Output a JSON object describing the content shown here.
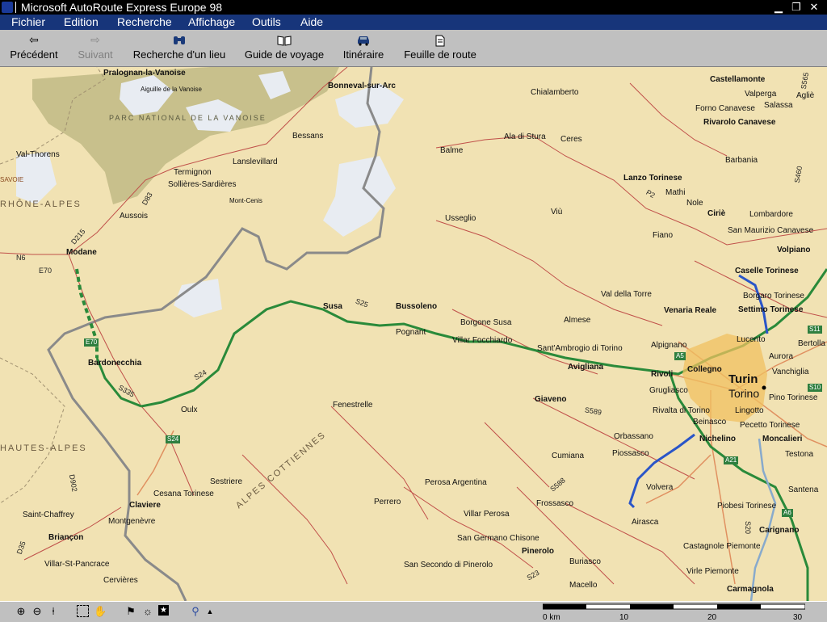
{
  "window": {
    "title": "Microsoft AutoRoute Express Europe 98"
  },
  "menu": [
    "Fichier",
    "Edition",
    "Recherche",
    "Affichage",
    "Outils",
    "Aide"
  ],
  "toolbar": [
    {
      "label": "Précédent",
      "icon": "back-arrow-icon",
      "enabled": true
    },
    {
      "label": "Suivant",
      "icon": "forward-arrow-icon",
      "enabled": false
    },
    {
      "label": "Recherche d'un lieu",
      "icon": "binoculars-icon",
      "enabled": true
    },
    {
      "label": "Guide de voyage",
      "icon": "book-icon",
      "enabled": true
    },
    {
      "label": "Itinéraire",
      "icon": "car-icon",
      "enabled": true
    },
    {
      "label": "Feuille de route",
      "icon": "document-icon",
      "enabled": true
    }
  ],
  "map": {
    "places": [
      "Pralognan-la-Vanoise",
      "Aiguille de la Vanoise",
      "Bonneval-sur-Arc",
      "PARC NATIONAL DE LA VANOISE",
      "Val-Thorens",
      "SAVOIE",
      "RHÔNE-ALPES",
      "Termignon",
      "Lanslevillard",
      "Sollières-Sardières",
      "Bessans",
      "Mont-Cenis",
      "Aussois",
      "Modane",
      "Bardonecchia",
      "Oulx",
      "Cesana Torinese",
      "Claviere",
      "Montgenèvre",
      "Sestriere",
      "Saint-Chaffrey",
      "Briançon",
      "Villar-St-Pancrace",
      "Cervières",
      "HAUTES-ALPES",
      "ALPES COTTIENNES",
      "Fenestrelle",
      "Perrero",
      "Perosa Argentina",
      "Villar Perosa",
      "San Germano Chisone",
      "Pinerolo",
      "San Secondo di Pinerolo",
      "Buriasco",
      "Macello",
      "Frossasco",
      "Cumiana",
      "Airasca",
      "Volvera",
      "Piossasco",
      "Orbassano",
      "Giaveno",
      "Avigliana",
      "Sant'Ambrogio di Torino",
      "Villar Focchiardo",
      "Borgone Susa",
      "Almese",
      "Bussoleno",
      "Pognant",
      "Susa",
      "Usseglio",
      "Balme",
      "Ala di Stura",
      "Ceres",
      "Chialamberto",
      "Viù",
      "Lanzo Torinese",
      "Mathi",
      "Nole",
      "Ciriè",
      "Fiano",
      "Val della Torre",
      "Venaria Reale",
      "Alpignano",
      "Rivoli",
      "Collegno",
      "Grugliasco",
      "Rivalta di Torino",
      "Beinasco",
      "Nichelino",
      "Turin",
      "Torino",
      "Lingotto",
      "Pecetto Torinese",
      "Moncalieri",
      "Testona",
      "Santena",
      "Piobesi Torinese",
      "Carignano",
      "Castagnole Piemonte",
      "Virle Piemonte",
      "Carmagnola",
      "Pino Torinese",
      "Vanchiglia",
      "Aurora",
      "Lucento",
      "Borgaro Torinese",
      "Settimo Torinese",
      "Caselle Torinese",
      "Volpiano",
      "San Maurizio Canavese",
      "Lombardore",
      "Barbania",
      "Rivarolo Canavese",
      "Forno Canavese",
      "Valperga",
      "Salassa",
      "Agliè",
      "Castellamonte",
      "Bertolla"
    ],
    "roads": [
      "N6",
      "E70",
      "D215",
      "D83",
      "S24",
      "S25",
      "S335",
      "S589",
      "S588",
      "S23",
      "A5",
      "A21",
      "A6",
      "S20",
      "S10",
      "S11",
      "S460",
      "S565",
      "D902",
      "D35",
      "P2"
    ]
  },
  "statusbar": {
    "icons": [
      "zoom-in-icon",
      "zoom-out-icon",
      "pushpin-icon",
      "select-icon",
      "pan-hand-icon",
      "flag-icon",
      "sun-icon",
      "star-icon",
      "route-pin-icon",
      "arrow-up-icon"
    ],
    "scale": {
      "labels": [
        "0 km",
        "10",
        "20",
        "30"
      ]
    }
  }
}
